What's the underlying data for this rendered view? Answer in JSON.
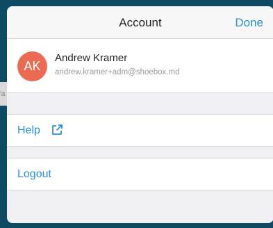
{
  "backdrop": {
    "peek_text": "Pa"
  },
  "navbar": {
    "title": "Account",
    "done_label": "Done"
  },
  "account": {
    "initials": "AK",
    "name": "Andrew Kramer",
    "email": "andrew.kramer+adm@shoebox.md",
    "avatar_color": "#ea6a52"
  },
  "menu": {
    "help_label": "Help",
    "help_icon": "external-link-icon",
    "logout_label": "Logout"
  },
  "colors": {
    "accent": "#2a8fd0",
    "backdrop": "#0f4a63"
  }
}
